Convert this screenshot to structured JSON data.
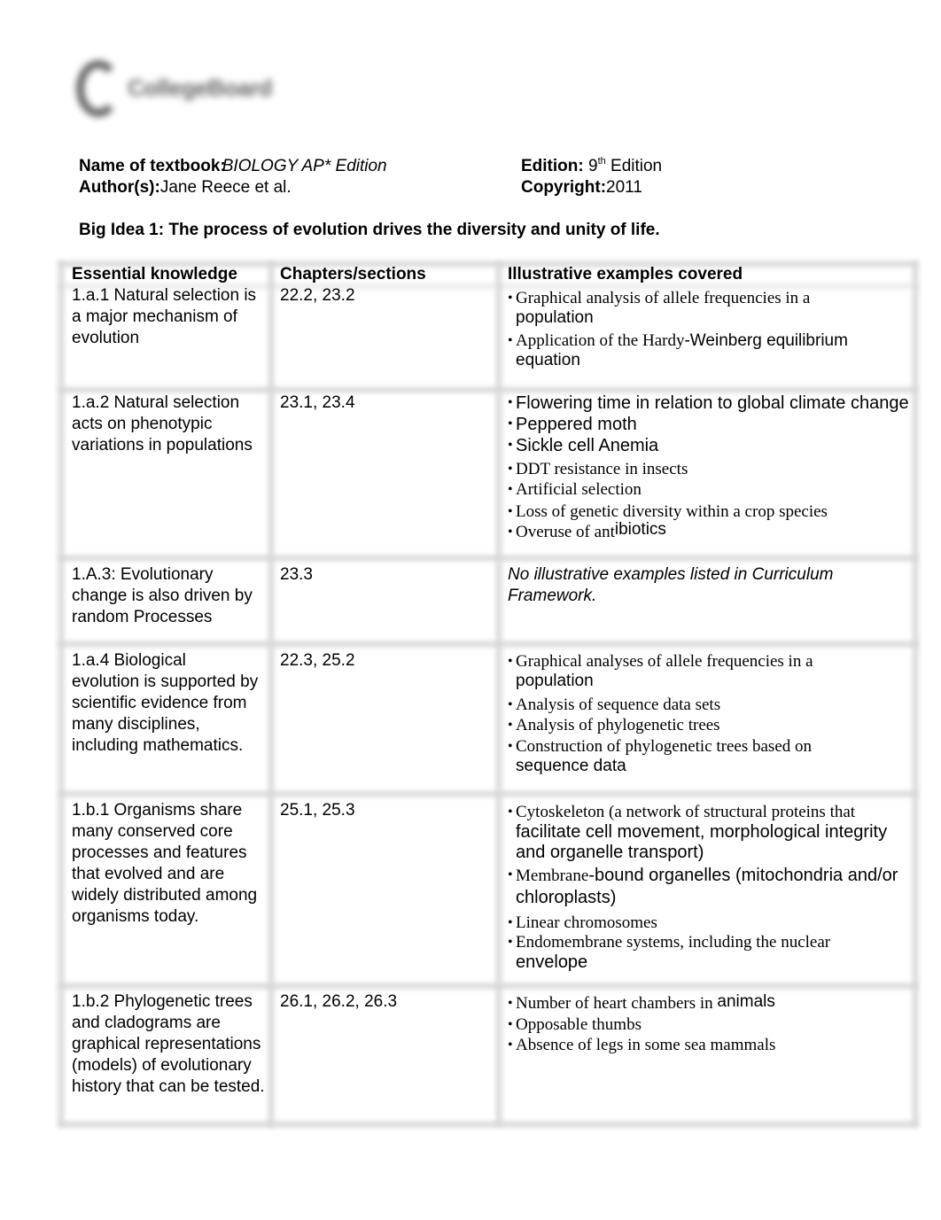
{
  "logo": {
    "text": "CollegeBoard",
    "icon": "collegeboard-acorn-logo"
  },
  "header": {
    "textbook_label": "Name of textbook:",
    "textbook_value": "BIOLOGY AP* Edition",
    "authors_label": "Author(s):",
    "authors_value": "Jane Reece et al.",
    "edition_label": "Edition:",
    "edition_number": "9",
    "edition_suffix": "th",
    "edition_word": "Edition",
    "copyright_label": "Copyright:",
    "copyright_value": "2011"
  },
  "big_idea": "Big Idea 1: The process of evolution drives the diversity and unity of life.",
  "table": {
    "headers": [
      "Essential knowledge",
      "Chapters/sections",
      "Illustrative examples covered"
    ],
    "rows": [
      {
        "knowledge": "1.a.1 Natural selection is a major mechanism of evolution",
        "chapters": "22.2, 23.2",
        "examples": [
          "Graphical analysis of allele frequencies in a population",
          "Application of the Hardy-Weinberg equilibrium equation"
        ]
      },
      {
        "knowledge": "1.a.2 Natural selection acts on phenotypic variations in populations",
        "chapters": "23.1, 23.4",
        "examples": [
          "Flowering time in relation to global climate change",
          "Peppered moth",
          "Sickle cell Anemia",
          "DDT resistance in insects",
          "Artificial selection",
          "Loss of genetic diversity within a crop species",
          "Overuse of antibiotics"
        ]
      },
      {
        "knowledge": "1.A.3: Evolutionary change is also driven by random Processes",
        "chapters": "23.3",
        "note": "No illustrative examples listed in Curriculum Framework."
      },
      {
        "knowledge": "1.a.4 Biological evolution is supported by scientific evidence from many disciplines, including mathematics.",
        "chapters": "22.3, 25.2",
        "examples": [
          "Graphical analyses of allele frequencies in a population",
          "Analysis of sequence data sets",
          "Analysis of phylogenetic trees",
          "Construction of phylogenetic trees based on sequence data"
        ]
      },
      {
        "knowledge": "1.b.1 Organisms share many conserved core processes and features that evolved and are widely distributed among organisms today.",
        "chapters": "25.1, 25.3",
        "examples": [
          "Cytoskeleton (a network of structural proteins that facilitate cell movement, morphological integrity and organelle transport)",
          "Membrane-bound organelles (mitochondria and/or chloroplasts)",
          "Linear chromosomes",
          "Endomembrane systems, including the nuclear envelope"
        ]
      },
      {
        "knowledge": "1.b.2 Phylogenetic trees and cladograms are graphical representations (models) of evolutionary history that can be tested.",
        "chapters": "26.1, 26.2, 26.3",
        "examples": [
          "Number of heart chambers in animals",
          "Opposable thumbs",
          "Absence of legs in some sea mammals"
        ]
      }
    ]
  },
  "display_lines": {
    "r1": {
      "k": [
        "1.a.1 Natural selection is",
        "a major mechanism of",
        "evolution"
      ],
      "e0a": "Graphical analysis of allele frequencies in a",
      "e0b": "population",
      "e1a": "Application of the Hardy",
      "e1b": "-Weinberg equilibrium",
      "e1c": "equation"
    },
    "r2": {
      "k": [
        "1.a.2 Natural selection",
        "acts on phenotypic",
        "variations in populations"
      ],
      "e3a": "Overuse of ant",
      "e3b": "ibiotics"
    },
    "r3": {
      "k": [
        "1.A.3: Evolutionary",
        "change is also driven by",
        "random Processes"
      ],
      "n": [
        "No illustrative examples listed in Curriculum",
        "Framework."
      ]
    },
    "r4": {
      "k": [
        "1.a.4 Biological",
        "evolution is supported by",
        "scientific evidence from",
        "many disciplines,",
        "including mathematics."
      ],
      "e0a": "Graphical analyses of allele frequencies in a",
      "e0b": "population",
      "e3a": "Construction of phylogenetic trees based on",
      "e3b": "sequence data"
    },
    "r5": {
      "k": [
        "1.b.1 Organisms share",
        "many conserved core",
        "processes and features",
        "that evolved and are",
        "widely distributed among",
        "organisms today."
      ],
      "e0a": "Cytoskeleton (a network of structural proteins that",
      "e0b": "facilitate cell movement, morphological integrity",
      "e0c": "and organelle transport)",
      "e1a": "Membrane",
      "e1b": "-bound organelles (mitochondria and/or",
      "e1c": "chloroplasts)",
      "e3a": "Endomembrane systems, including the nuclear",
      "e3b": "envelope"
    },
    "r6": {
      "k": [
        "1.b.2 Phylogenetic trees",
        "and cladograms are",
        "graphical representations",
        "(models) of evolutionary",
        "history that can be tested."
      ],
      "e0a": "Number of heart chambers in",
      "e0b": "animals"
    }
  }
}
